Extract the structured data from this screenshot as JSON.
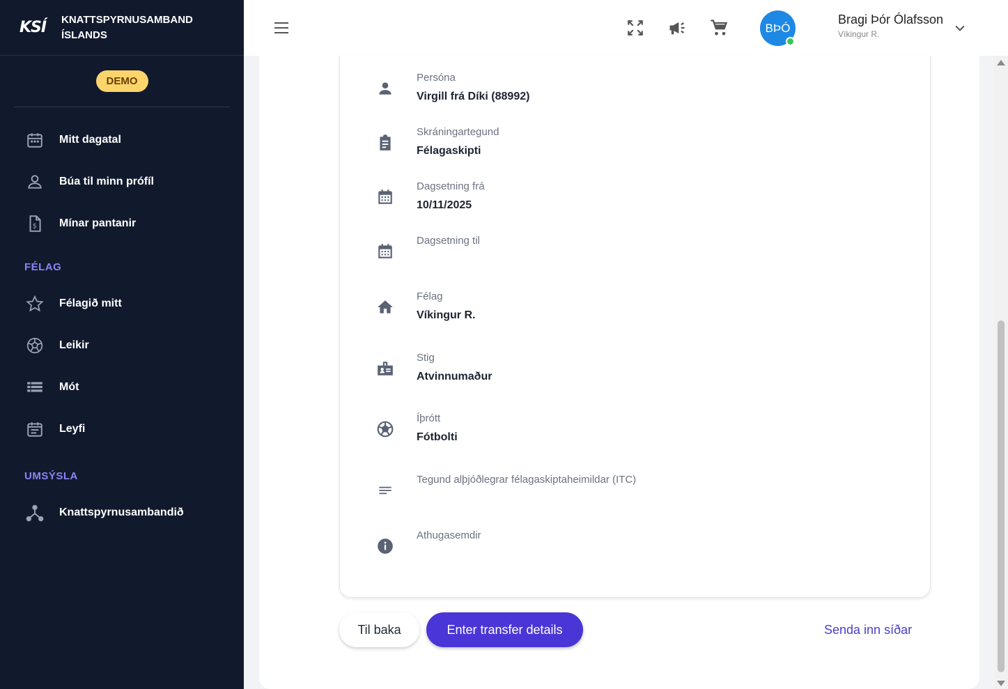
{
  "brand": {
    "logo": "KSÍ",
    "name_line1": "KNATTSPYRNUSAMBAND",
    "name_line2": "ÍSLANDS",
    "badge": "DEMO"
  },
  "sidebar": {
    "items": [
      {
        "label": "Mitt dagatal",
        "icon": "calendar-icon"
      },
      {
        "label": "Búa til minn prófíl",
        "icon": "person-icon"
      },
      {
        "label": "Mínar pantanir",
        "icon": "invoice-icon"
      }
    ],
    "section_felag": "FÉLAG",
    "felag_items": [
      {
        "label": "Félagið mitt",
        "icon": "star-icon"
      },
      {
        "label": "Leikir",
        "icon": "soccer-ball-icon"
      },
      {
        "label": "Mót",
        "icon": "list-icon"
      },
      {
        "label": "Leyfi",
        "icon": "event-note-icon"
      }
    ],
    "section_umsysla": "UMSÝSLA",
    "umsysla_items": [
      {
        "label": "Knattspyrnusambandið",
        "icon": "hub-icon"
      }
    ]
  },
  "header": {
    "avatar_initials": "BÞÓ",
    "user_name": "Bragi Þór Ólafsson",
    "user_club": "Víkingur R."
  },
  "fields": [
    {
      "label": "Persóna",
      "value": "Virgill frá Díki (88992)",
      "icon": "person-icon"
    },
    {
      "label": "Skráningartegund",
      "value": "Félagaskipti",
      "icon": "clipboard-icon"
    },
    {
      "label": "Dagsetning frá",
      "value": "10/11/2025",
      "icon": "calendar-icon"
    },
    {
      "label": "Dagsetning til",
      "value": "",
      "icon": "calendar-icon"
    },
    {
      "label": "Félag",
      "value": "Víkingur R.",
      "icon": "home-icon"
    },
    {
      "label": "Stig",
      "value": "Atvinnumaður",
      "icon": "badge-icon"
    },
    {
      "label": "Íþrótt",
      "value": "Fótbolti",
      "icon": "soccer-ball-icon"
    },
    {
      "label": "Tegund alþjóðlegrar félagaskiptaheimildar (ITC)",
      "value": "",
      "icon": "notes-icon"
    },
    {
      "label": "Athugasemdir",
      "value": "",
      "icon": "info-icon"
    }
  ],
  "actions": {
    "back": "Til baka",
    "primary": "Enter transfer details",
    "send_later": "Senda inn síðar"
  },
  "colors": {
    "sidebar_bg": "#111a2d",
    "accent": "#4a35d6",
    "section": "#8b84f5",
    "demo_badge": "#fbd56b"
  }
}
